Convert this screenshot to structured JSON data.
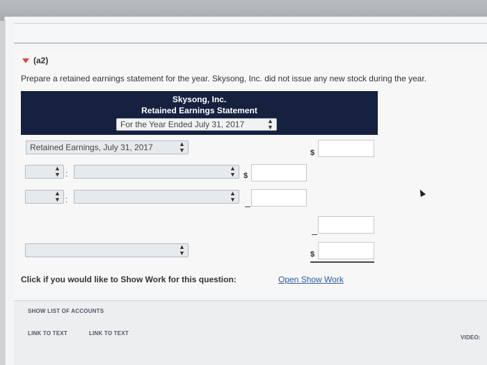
{
  "section": {
    "label": "(a2)"
  },
  "instructions": "Prepare a retained earnings statement for the year. Skysong, Inc. did not issue any new stock during the year.",
  "statement": {
    "company": "Skysong, Inc.",
    "title": "Retained Earnings Statement",
    "period_select": "For the Year Ended July 31, 2017"
  },
  "rows": {
    "row1_select": "Retained Earnings, July 31, 2017",
    "currency": "$"
  },
  "show_work": {
    "prompt": "Click if you would like to Show Work for this question:",
    "link": "Open Show Work"
  },
  "footer": {
    "show_list": "SHOW LIST OF ACCOUNTS",
    "link1": "LINK TO TEXT",
    "link2": "LINK TO TEXT",
    "video": "VIDEO:"
  },
  "icons": {
    "expand": "triangle-down-icon",
    "select_arrows": "updown-arrows-icon",
    "cursor": "mouse-pointer-icon"
  },
  "colors": {
    "banner": "#15213e",
    "link": "#2a5d99",
    "toggle": "#d9463c"
  }
}
